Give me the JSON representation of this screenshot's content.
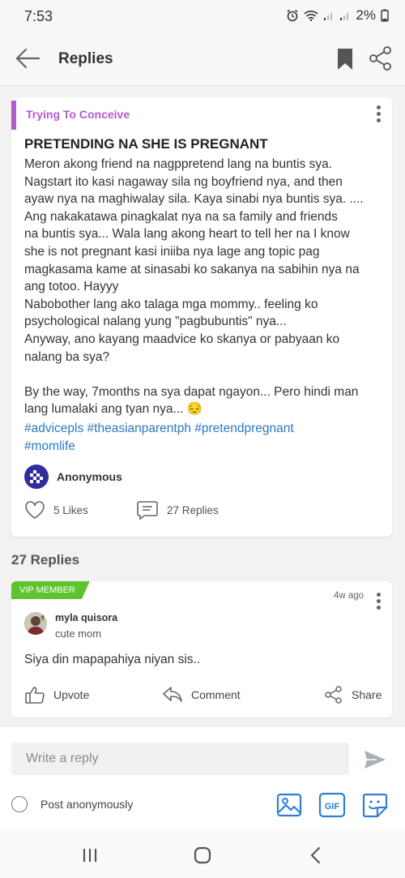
{
  "status": {
    "time": "7:53",
    "battery": "2%"
  },
  "appbar": {
    "title": "Replies"
  },
  "post": {
    "category": "Trying To Conceive",
    "title": "PRETENDING NA SHE IS PREGNANT",
    "body": "Meron akong friend na nagppretend lang na buntis sya.\nNagstart ito kasi nagaway sila ng boyfriend nya, and then\nayaw nya na maghiwalay sila. Kaya sinabi nya buntis sya. ....\nAng nakakatawa pinagkalat nya na sa family and friends\nna buntis sya... Wala lang akong heart to tell her na I know\nshe is not pregnant kasi iniiba nya lage ang topic pag\nmagkasama kame at sinasabi ko sakanya na sabihin nya na\nang totoo. Hayyy\nNabobother lang ako talaga mga mommy.. feeling ko\npsychological nalang yung \"pagbubuntis\" nya...\nAnyway, ano kayang maadvice ko skanya or pabyaan ko\nnalang ba sya?\n\nBy the way, 7months na sya dapat ngayon... Pero hindi man\nlang lumalaki ang tyan nya... 😔",
    "hashtags_line1": "#advicepls #theasianparentph #pretendpregnant",
    "hashtags_line2": "#momlife",
    "author": "Anonymous",
    "likes": "5 Likes",
    "replies": "27 Replies"
  },
  "replies_header": "27 Replies",
  "reply": {
    "badge": "VIP MEMBER",
    "ago": "4w ago",
    "user": "myla quisora",
    "tag": "cute mom",
    "text": "Siya din mapapahiya niyan sis..",
    "upvote": "Upvote",
    "comment": "Comment",
    "share": "Share"
  },
  "composer": {
    "placeholder": "Write a reply",
    "anon_label": "Post anonymously"
  },
  "colors": {
    "accent": "#3b7fd4",
    "category": "#b25ccc",
    "vip": "#5fc32e",
    "hashtag": "#2a79c4"
  }
}
